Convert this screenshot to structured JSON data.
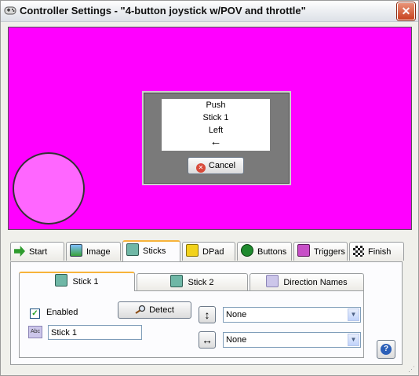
{
  "window": {
    "title": "Controller Settings - \"4-button joystick w/POV and throttle\"",
    "close_label": "✕"
  },
  "canvas": {
    "background": "#ff00ff",
    "prompt_lines": [
      "Push",
      "Stick 1",
      "Left"
    ],
    "prompt_arrow": "←",
    "cancel_label": "Cancel"
  },
  "tabs": [
    {
      "label": "Start",
      "icon": "arrow-right-icon",
      "active": false
    },
    {
      "label": "Image",
      "icon": "image-icon",
      "active": false
    },
    {
      "label": "Sticks",
      "icon": "joystick-icon",
      "active": true
    },
    {
      "label": "DPad",
      "icon": "dpad-icon",
      "active": false
    },
    {
      "label": "Buttons",
      "icon": "button-icon",
      "active": false
    },
    {
      "label": "Triggers",
      "icon": "trigger-icon",
      "active": false
    },
    {
      "label": "Finish",
      "icon": "checkered-flag-icon",
      "active": false
    }
  ],
  "subtabs": [
    {
      "label": "Stick 1",
      "active": true
    },
    {
      "label": "Stick 2",
      "active": false
    },
    {
      "label": "Direction Names",
      "active": false
    }
  ],
  "stick": {
    "enabled_label": "Enabled",
    "enabled_checked": true,
    "detect_label": "Detect",
    "name_value": "Stick 1",
    "vertical_axis": "None",
    "horizontal_axis": "None"
  },
  "help_label": "?"
}
